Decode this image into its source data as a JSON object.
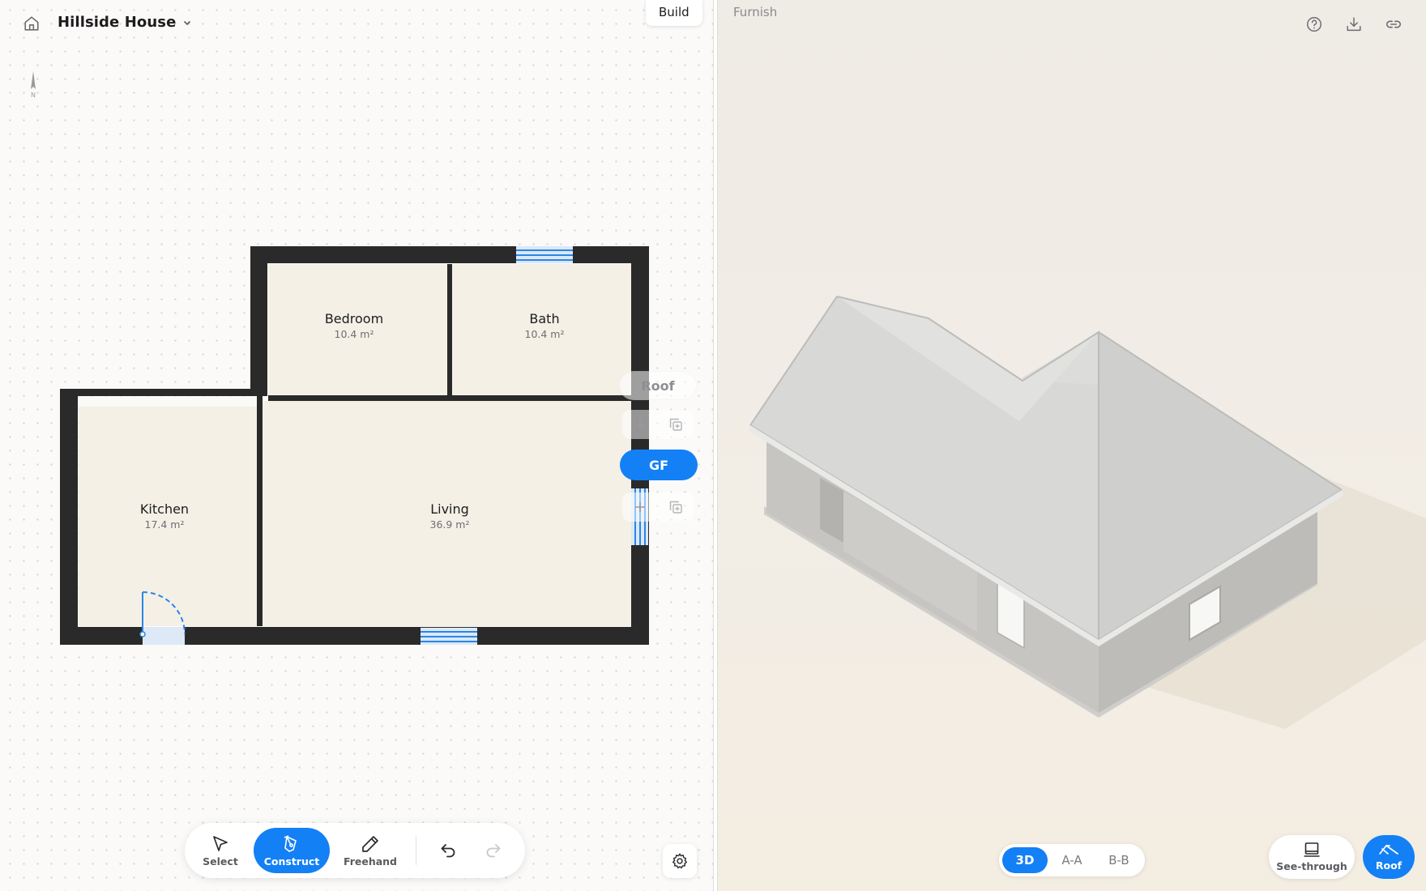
{
  "header": {
    "home_icon": "home-icon",
    "project_title": "Hillside House",
    "compass_label": "N"
  },
  "modes": {
    "build": "Build",
    "furnish": "Furnish"
  },
  "rooms": [
    {
      "name": "Bedroom",
      "area": "10.4 m²"
    },
    {
      "name": "Bath",
      "area": "10.4 m²"
    },
    {
      "name": "Kitchen",
      "area": "17.4 m²"
    },
    {
      "name": "Living",
      "area": "36.9 m²"
    }
  ],
  "levels": {
    "roof": "Roof",
    "ground": "GF"
  },
  "toolbar": {
    "select": "Select",
    "construct": "Construct",
    "freehand": "Freehand"
  },
  "views": {
    "view_3d": "3D",
    "section_a": "A-A",
    "section_b": "B-B"
  },
  "view_controls": {
    "see_through": "See-through",
    "roof": "Roof"
  },
  "colors": {
    "accent": "#1380f5",
    "wall": "#2a2a2a",
    "floor": "#f4f0e6",
    "window": "#2a86e6"
  }
}
